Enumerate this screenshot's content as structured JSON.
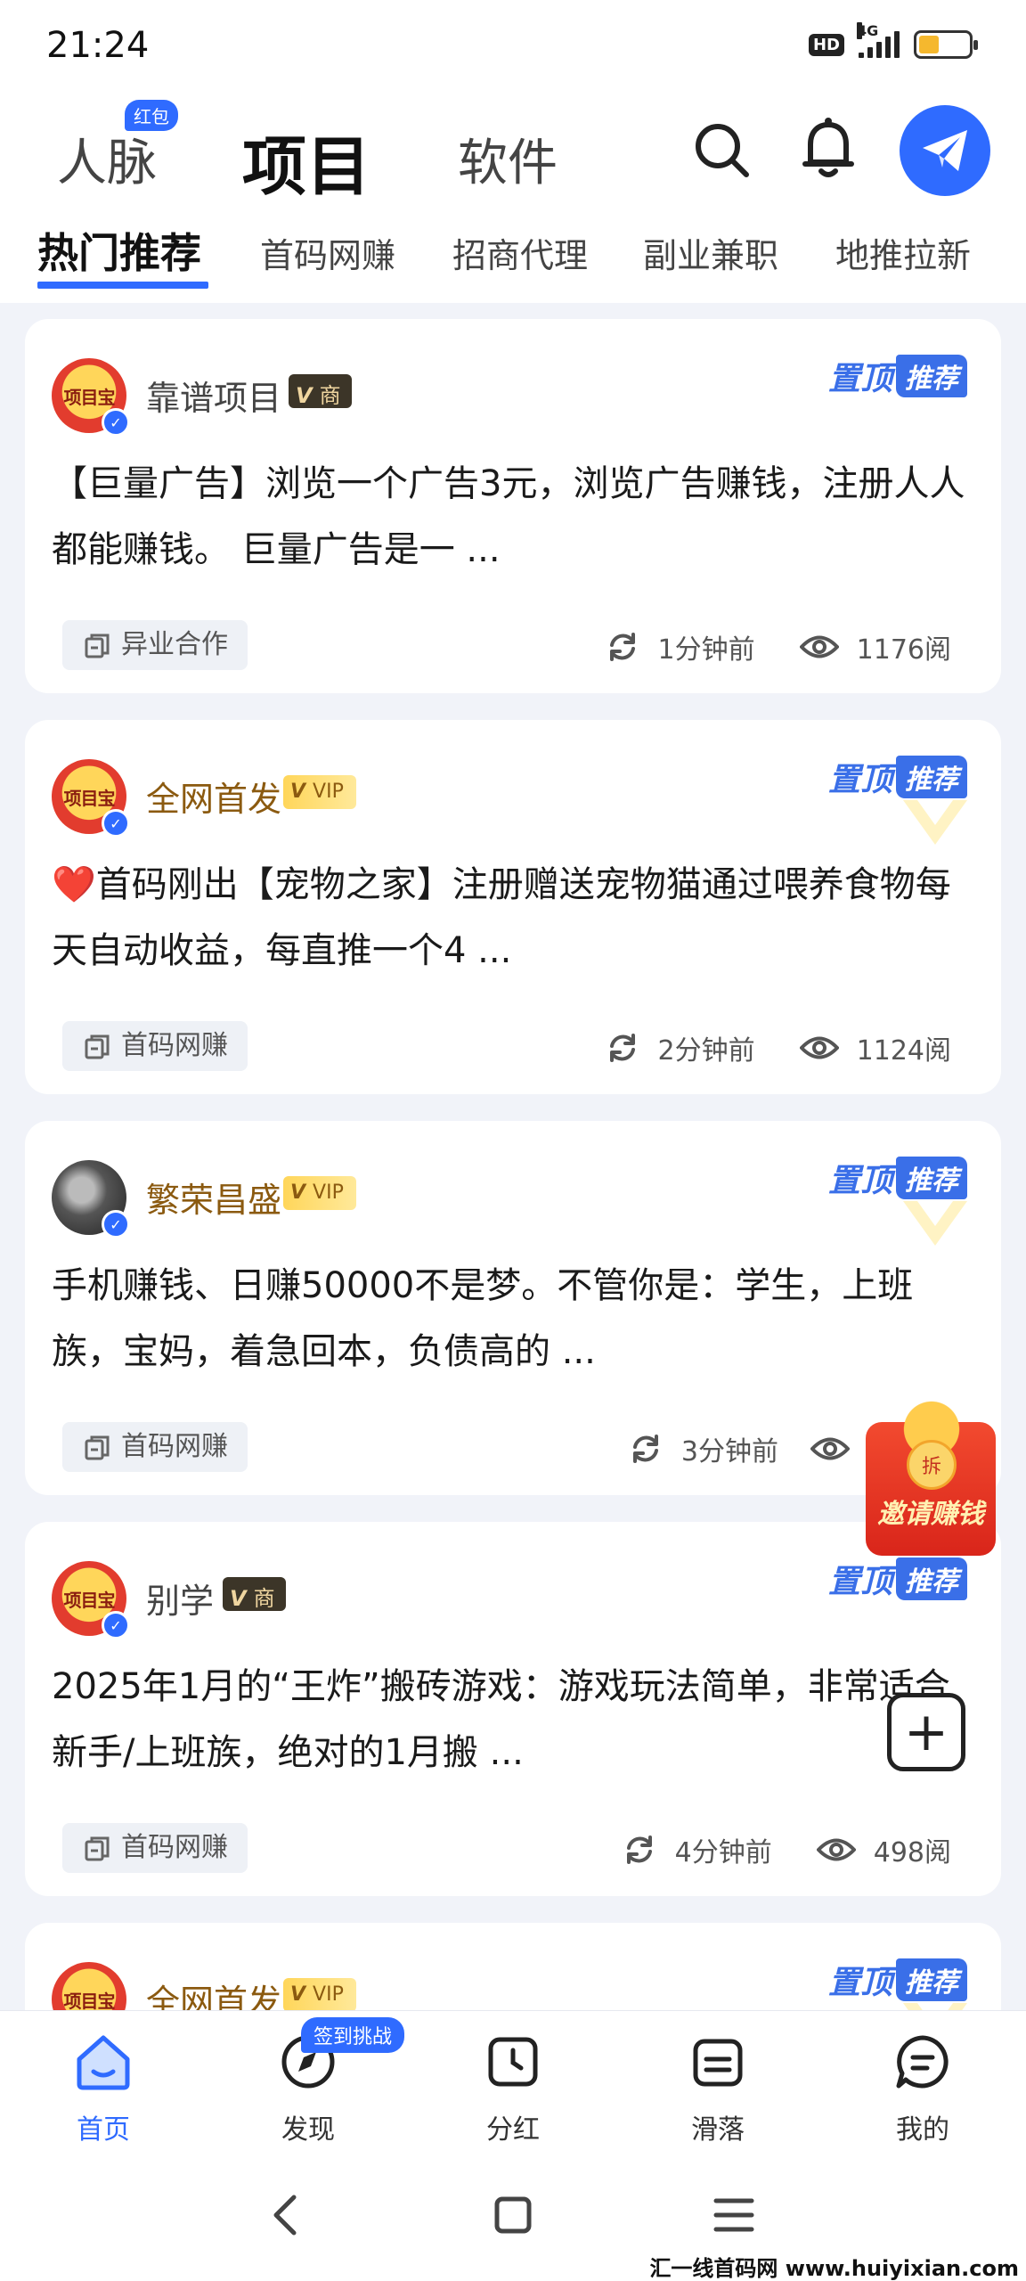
{
  "status_bar": {
    "time": "21:24",
    "hd": "HD",
    "network": "4G"
  },
  "header": {
    "tabs": [
      {
        "label": "人脉",
        "badge": "红包"
      },
      {
        "label": "项目"
      },
      {
        "label": "软件"
      }
    ]
  },
  "category_tabs": [
    "热门推荐",
    "首码网赚",
    "招商代理",
    "副业兼职",
    "地推拉新"
  ],
  "pin": {
    "text": "置顶",
    "recommend": "推荐"
  },
  "posts": [
    {
      "author": "靠谱项目",
      "badge_v": "V",
      "badge_text": "商",
      "avatar_text": "项目宝",
      "title": "【巨量广告】浏览一个广告3元，浏览广告赚钱，注册人人都能赚钱。 巨量广告是一 ...",
      "tag": "异业合作",
      "time": "1分钟前",
      "views": "1176阅"
    },
    {
      "author": "全网首发",
      "badge_v": "V",
      "badge_text": "VIP",
      "avatar_text": "项目宝",
      "title": "❤️首码刚出【宠物之家】注册赠送宠物猫通过喂养食物每天自动收益，每直推一个4 ...",
      "tag": "首码网赚",
      "time": "2分钟前",
      "views": "1124阅"
    },
    {
      "author": "繁荣昌盛",
      "badge_v": "V",
      "badge_text": "VIP",
      "avatar_text": "",
      "title": "手机赚钱、日赚50000不是梦。不管你是：学生，上班族，宝妈，着急回本，负债高的 ...",
      "tag": "首码网赚",
      "time": "3分钟前",
      "views": ""
    },
    {
      "author": "别学",
      "badge_v": "V",
      "badge_text": "商",
      "avatar_text": "项目宝",
      "title": "2025年1月的“王炸”搬砖游戏：游戏玩法简单，非常适合新手/上班族，绝对的1月搬 ...",
      "tag": "首码网赚",
      "time": "4分钟前",
      "views": "498阅"
    },
    {
      "author": "全网首发",
      "badge_v": "V",
      "badge_text": "VIP",
      "avatar_text": "项目宝"
    }
  ],
  "floating": {
    "invite": "邀请赚钱",
    "coin": "拆"
  },
  "bottom_nav": {
    "items": [
      "首页",
      "发现",
      "分红",
      "滑落",
      "我的"
    ],
    "signin_badge": "签到挑战"
  },
  "watermark": "汇一线首码网 www.huiyixian.com",
  "colors": {
    "accent": "#2f6bff",
    "pin": "#3a6fe8",
    "vip": "#ffd65a"
  }
}
